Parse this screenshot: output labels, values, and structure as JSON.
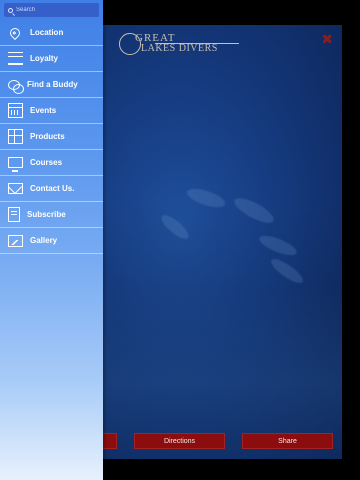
{
  "search": {
    "placeholder": "Search"
  },
  "menu": {
    "items": [
      {
        "label": "Location",
        "icon": "location-pin-icon"
      },
      {
        "label": "Loyalty",
        "icon": "list-icon"
      },
      {
        "label": "Find a Buddy",
        "icon": "chat-bubbles-icon"
      },
      {
        "label": "Events",
        "icon": "calendar-icon"
      },
      {
        "label": "Products",
        "icon": "products-grid-icon"
      },
      {
        "label": "Courses",
        "icon": "monitor-icon"
      },
      {
        "label": "Contact Us.",
        "icon": "envelope-icon"
      },
      {
        "label": "Subscribe",
        "icon": "document-icon"
      },
      {
        "label": "Gallery",
        "icon": "picture-icon"
      }
    ]
  },
  "main": {
    "logo": {
      "line1": "GREAT",
      "line2": "LAKES DIVERS"
    },
    "close_icon": "✖",
    "buttons": {
      "call": "",
      "directions": "Directions",
      "share": "Share"
    }
  },
  "colors": {
    "drawer_top": "#3f7fe6",
    "drawer_bottom": "#e7f1fd",
    "button_red": "#8b0d0d",
    "water": "#173f86"
  }
}
